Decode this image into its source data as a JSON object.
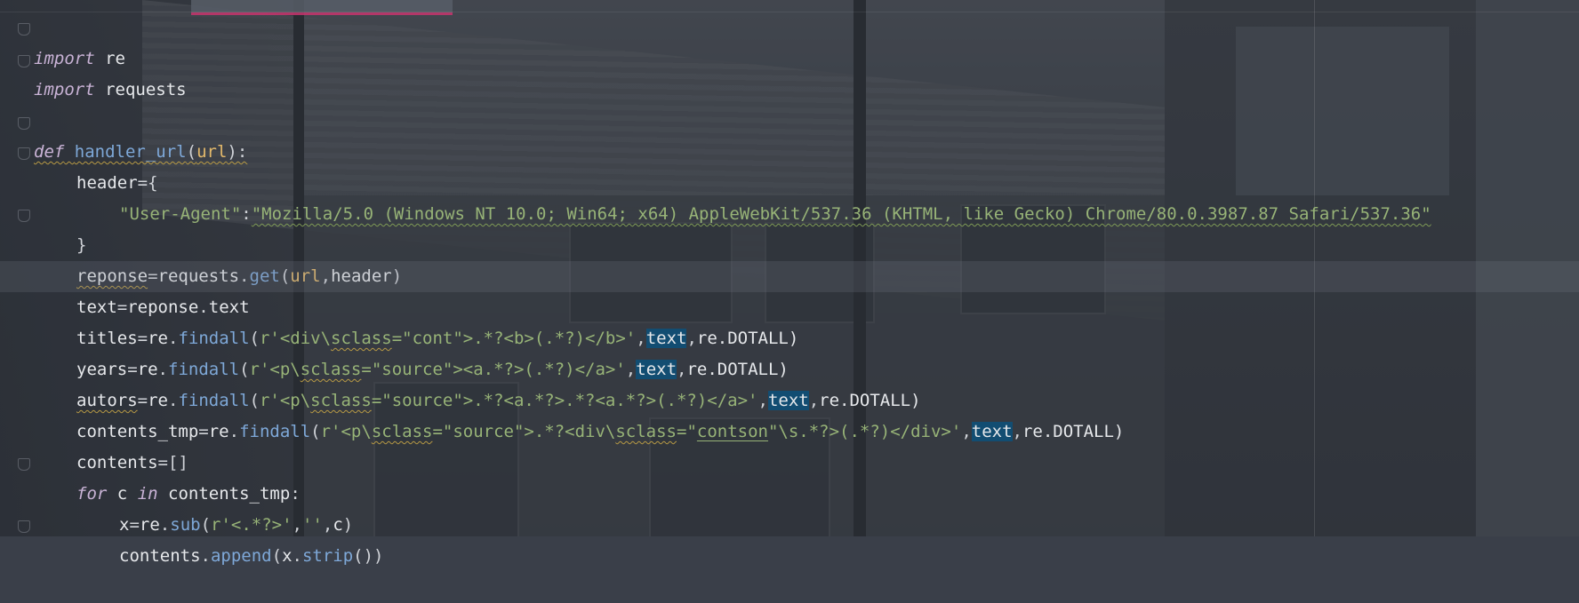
{
  "editor": {
    "lines": {
      "l1": {
        "kw": "import",
        "mod": "re"
      },
      "l2": {
        "kw": "import",
        "mod": "requests"
      },
      "l3": {
        "kw": "def",
        "name": "handler_url",
        "open": "(",
        "param": "url",
        "close": "):"
      },
      "l4": {
        "var": "header",
        "op": "={"
      },
      "l5": {
        "key": "\"User-Agent\"",
        "sep": ":",
        "value": "\"Mozilla/5.0 (Windows NT 10.0; Win64; x64) AppleWebKit/537.36 (KHTML, like Gecko) Chrome/80.0.3987.87 Safari/537.36\""
      },
      "l6": {
        "text": "}"
      },
      "l7": {
        "var": "reponse",
        "eq": "=",
        "obj": "requests",
        "dot": ".",
        "meth": "get",
        "open": "(",
        "a1": "url",
        "comma": ",",
        "a2": "header",
        "close": ")"
      },
      "l8": {
        "var": "text",
        "eq": "=",
        "obj": "reponse",
        "dot": ".",
        "attr": "text"
      },
      "l9": {
        "var": "titles",
        "eq": "=",
        "obj": "re",
        "dot": ".",
        "meth": "findall",
        "open": "(",
        "str_pre": "r'<div\\",
        "str_cls": "sclass",
        "str_post": "=\"cont\">.*?<b>(.*?)</b>'",
        "comma1": ",",
        "arg": "text",
        "comma2": ",",
        "flag": "re.DOTALL)"
      },
      "l10": {
        "var": "years",
        "eq": "=",
        "obj": "re",
        "dot": ".",
        "meth": "findall",
        "open": "(",
        "str_pre": "r'<p\\",
        "str_cls": "sclass",
        "str_post": "=\"source\"><a.*?>(.*?)</a>'",
        "comma1": ",",
        "arg": "text",
        "comma2": ",",
        "flag": "re.DOTALL)"
      },
      "l11": {
        "var": "autors",
        "eq": "=",
        "obj": "re",
        "dot": ".",
        "meth": "findall",
        "open": "(",
        "str_pre": "r'<p\\",
        "str_cls": "sclass",
        "str_post": "=\"source\">.*?<a.*?>.*?<a.*?>(.*?)</a>'",
        "comma1": ",",
        "arg": "text",
        "comma2": ",",
        "flag": "re.DOTALL)"
      },
      "l12": {
        "var": "contents_tmp",
        "eq": "=",
        "obj": "re",
        "dot": ".",
        "meth": "findall",
        "open": "(",
        "str_pre": "r'<p\\",
        "str_cls": "sclass",
        "str_mid": "=\"source\">.*?<div\\",
        "str_cls2": "sclass",
        "str_mid2": "=\"",
        "str_word": "contson",
        "str_post": "\"\\s.*?>(.*?)</div>'",
        "comma1": ",",
        "arg": "text",
        "comma2": ",",
        "flag": "re.DOTALL)"
      },
      "l13": {
        "var": "contents",
        "eq": "=",
        "rest": "[]"
      },
      "l14": {
        "kw": "for",
        "v": "c",
        "kw2": "in",
        "iter": "contents_tmp",
        "colon": ":"
      },
      "l15": {
        "var": "x",
        "eq": "=",
        "obj": "re",
        "dot": ".",
        "meth": "sub",
        "open": "(",
        "s1": "r'<.*?>'",
        "c1": ",",
        "s2": "''",
        "c2": ",",
        "a": "c",
        "close": ")"
      },
      "l16": {
        "obj": "contents",
        "dot": ".",
        "meth": "append",
        "open": "(",
        "a": "x",
        "dot2": ".",
        "meth2": "strip",
        "close": "())"
      }
    }
  }
}
